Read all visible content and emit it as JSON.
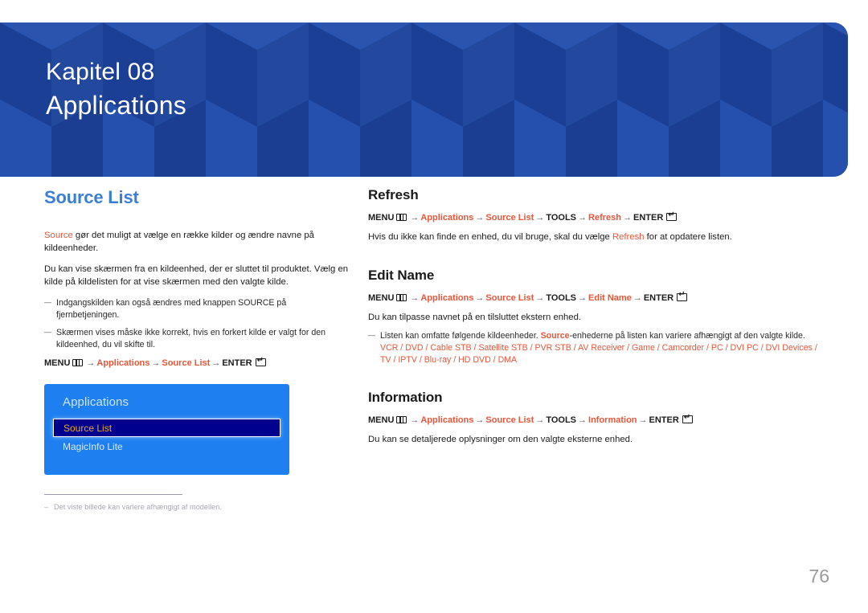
{
  "banner": {
    "chapter_label": "Kapitel 08",
    "chapter_name": "Applications",
    "bg_color": "#1e44a0"
  },
  "left_column": {
    "section_title": "Source List",
    "intro_highlight": "Source",
    "intro_rest": " gør det muligt at vælge en række kilder og ændre navne på kildeenheder.",
    "paragraph2": "Du kan vise skærmen fra en kildeenhed, der er sluttet til produktet. Vælg en kilde på kildelisten for at vise skærmen med den valgte kilde.",
    "notes": [
      "Indgangskilden kan også ændres med knappen SOURCE på fjernbetjeningen.",
      "Skærmen vises måske ikke korrekt, hvis en forkert kilde er valgt for den kildeenhed, du vil skifte til."
    ],
    "menu_path": {
      "menu_label": "MENU",
      "menu_icon": "menu-grid-icon",
      "steps": [
        "Applications",
        "Source List"
      ],
      "enter_label": "ENTER",
      "enter_icon": "enter-key-icon",
      "arrow": "→"
    },
    "osd": {
      "title": "Applications",
      "items": [
        {
          "label": "Source List",
          "selected": true
        },
        {
          "label": "MagicInfo Lite",
          "selected": false
        }
      ],
      "bg_color": "#1e7ff0",
      "selected_bg": "#00008f",
      "selected_text": "#eba820"
    },
    "footnote": "Det viste billede kan variere afhængigt af modellen."
  },
  "right_column": {
    "sections": [
      {
        "title": "Refresh",
        "menu_path": {
          "menu_label": "MENU",
          "steps": [
            "Applications",
            "Source List"
          ],
          "plain_step": "TOOLS",
          "final_step": "Refresh",
          "enter_label": "ENTER",
          "arrow": "→"
        },
        "body_pre": "Hvis du ikke kan finde en enhed, du vil bruge, skal du vælge ",
        "body_hl": "Refresh",
        "body_post": " for at opdatere listen."
      },
      {
        "title": "Edit Name",
        "menu_path": {
          "menu_label": "MENU",
          "steps": [
            "Applications",
            "Source List"
          ],
          "plain_step": "TOOLS",
          "final_step": "Edit Name",
          "enter_label": "ENTER",
          "arrow": "→"
        },
        "body_pre": "Du kan tilpasse navnet på en tilsluttet ekstern enhed.",
        "body_hl": "",
        "body_post": ""
      },
      {
        "title": "Information",
        "menu_path": {
          "menu_label": "MENU",
          "steps": [
            "Applications",
            "Source List"
          ],
          "plain_step": "TOOLS",
          "final_step": "Information",
          "enter_label": "ENTER",
          "arrow": "→"
        },
        "body_pre": "Du kan se detaljerede oplysninger om den valgte eksterne enhed.",
        "body_hl": "",
        "body_post": ""
      }
    ],
    "device_note": {
      "pre": "Listen kan omfatte følgende kildeenheder. ",
      "hl": "Source",
      "post": "-enhederne på listen kan variere afhængigt af den valgte kilde.",
      "device_line1": "VCR / DVD / Cable STB / Satellite STB / PVR STB / AV Receiver / Game / Camcorder / PC / DVI PC / DVI Devices /",
      "device_line2": "TV / IPTV / Blu-ray / HD DVD / DMA"
    }
  },
  "page_number": "76",
  "colors": {
    "accent_orange": "#e8563a",
    "title_blue": "#3a7fd5",
    "banner_blue": "#1e44a0",
    "page_number_gray": "#9b9b9b"
  }
}
